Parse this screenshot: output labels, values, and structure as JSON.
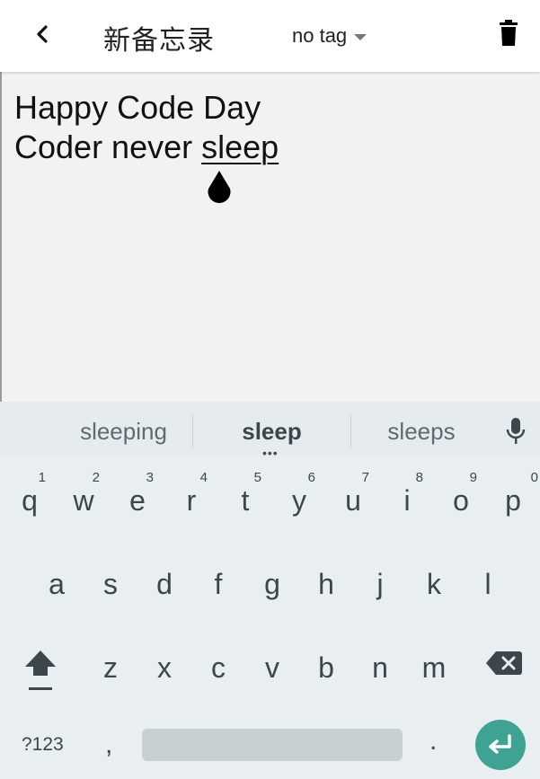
{
  "toolbar": {
    "title": "新备忘录",
    "tag_label": "no tag"
  },
  "editor": {
    "line1": "Happy Code Day",
    "line2_prefix": "Coder never ",
    "line2_word": "sleep"
  },
  "keyboard": {
    "suggestions": [
      "sleeping",
      "sleep",
      "sleeps"
    ],
    "more_indicator": "•••",
    "row1": [
      {
        "ch": "q",
        "hint": "1"
      },
      {
        "ch": "w",
        "hint": "2"
      },
      {
        "ch": "e",
        "hint": "3"
      },
      {
        "ch": "r",
        "hint": "4"
      },
      {
        "ch": "t",
        "hint": "5"
      },
      {
        "ch": "y",
        "hint": "6"
      },
      {
        "ch": "u",
        "hint": "7"
      },
      {
        "ch": "i",
        "hint": "8"
      },
      {
        "ch": "o",
        "hint": "9"
      },
      {
        "ch": "p",
        "hint": "0"
      }
    ],
    "row2": [
      "a",
      "s",
      "d",
      "f",
      "g",
      "h",
      "j",
      "k",
      "l"
    ],
    "row3": [
      "z",
      "x",
      "c",
      "v",
      "b",
      "n",
      "m"
    ],
    "num_label": "?123",
    "comma": ",",
    "period": "."
  },
  "colors": {
    "accent": "#3fa393",
    "keyboard_bg": "#e9eef1",
    "key_text": "#3b464d"
  }
}
